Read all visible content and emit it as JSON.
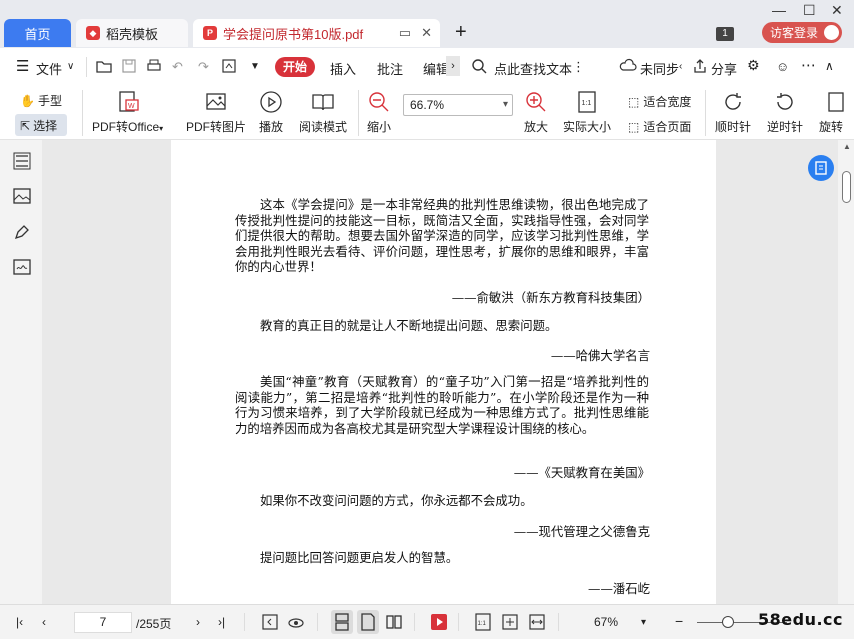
{
  "tabs": {
    "home": "首页",
    "template": "稻壳模板",
    "document": "学会提问原书第10版.pdf"
  },
  "titlebar": {
    "badge": "1",
    "login": "访客登录"
  },
  "menubar": {
    "file": "文件",
    "start": "开始",
    "insert": "插入",
    "annotate": "批注",
    "edit": "编辑",
    "search": "点此查找文本",
    "sync": "未同步",
    "share": "分享"
  },
  "ribbon": {
    "hand": "手型",
    "select": "选择",
    "pdf_to_office": "PDF转Office",
    "pdf_to_image": "PDF转图片",
    "play": "播放",
    "read_mode": "阅读模式",
    "zoom_out": "缩小",
    "zoom_value": "66.7%",
    "zoom_in": "放大",
    "actual_size": "实际大小",
    "fit_width": "适合宽度",
    "fit_page": "适合页面",
    "rotate_cw": "顺时针",
    "rotate_ccw": "逆时针",
    "rotate_more": "旋转"
  },
  "document": {
    "p1": "这本《学会提问》是一本非常经典的批判性思维读物，很出色地完成了传授批判性提问的技能这一目标，既简洁又全面，实践指导性强，会对同学们提供很大的帮助。想要去国外留学深造的同学，应该学习批判性思维，学会用批判性眼光去看待、评价问题，理性思考，扩展你的思维和眼界，丰富你的内心世界！",
    "s1": "——俞敏洪（新东方教育科技集团）",
    "p2": "教育的真正目的就是让人不断地提出问题、思索问题。",
    "s2": "——哈佛大学名言",
    "p3": "美国“神童”教育（天赋教育）的“童子功”入门第一招是“培养批判性的阅读能力”，第二招是培养“批判性的聆听能力”。在小学阶段还是作为一种行为习惯来培养，到了大学阶段就已经成为一种思维方式了。批判性思维能力的培养因而成为各高校尤其是研究型大学课程设计围绕的核心。",
    "s3": "——《天赋教育在美国》",
    "p4": "如果你不改变问问题的方式，你永远都不会成功。",
    "s4": "——现代管理之父德鲁克",
    "p5": "提问题比回答问题更启发人的智慧。",
    "s5": "——潘石屹"
  },
  "statusbar": {
    "page_current": "7",
    "page_total": "/255页",
    "zoom": "67%",
    "watermark": "58edu.cc"
  },
  "colors": {
    "accent": "#3d7bf0",
    "brand_red": "#d8323a"
  }
}
